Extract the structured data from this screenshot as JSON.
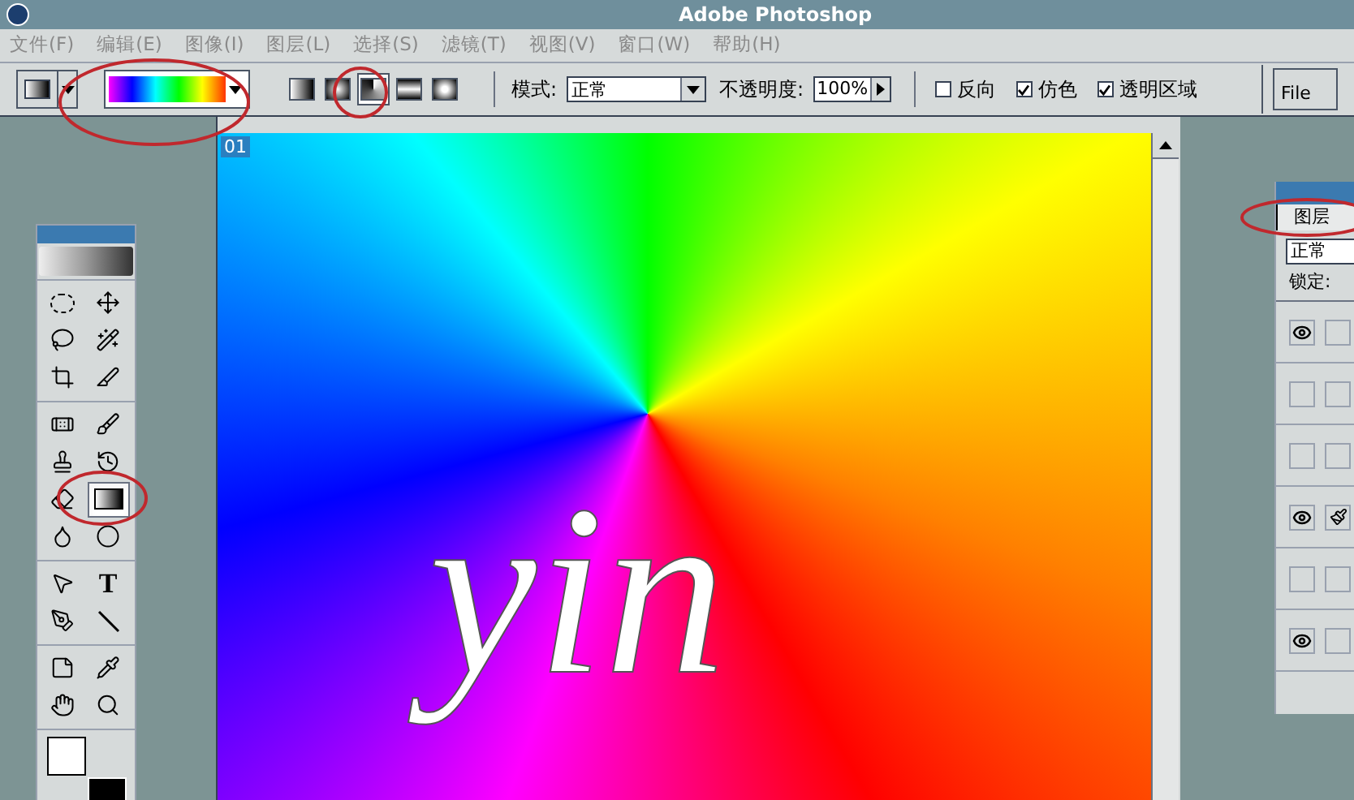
{
  "window": {
    "title": "Adobe Photoshop"
  },
  "menu": [
    "文件(F)",
    "编辑(E)",
    "图像(I)",
    "图层(L)",
    "选择(S)",
    "滤镜(T)",
    "视图(V)",
    "窗口(W)",
    "帮助(H)"
  ],
  "options_bar": {
    "gradient_types": [
      {
        "kind": "linear",
        "selected": false
      },
      {
        "kind": "radial",
        "selected": false
      },
      {
        "kind": "angle",
        "selected": true
      },
      {
        "kind": "reflected",
        "selected": false
      },
      {
        "kind": "diamond",
        "selected": false
      }
    ],
    "mode_label": "模式:",
    "mode": "正常",
    "opacity_label": "不透明度:",
    "opacity": "100%",
    "checkboxes": [
      {
        "label": "反向",
        "checked": false
      },
      {
        "label": "仿色",
        "checked": true
      },
      {
        "label": "透明区域",
        "checked": true
      }
    ],
    "palette_well": "File"
  },
  "document": {
    "corner_label": "01",
    "canvas_text": "yin"
  },
  "toolbox": {
    "tools": [
      {
        "kind": "marquee",
        "selected": false
      },
      {
        "kind": "move",
        "selected": false
      },
      {
        "kind": "lasso",
        "selected": false
      },
      {
        "kind": "wand",
        "selected": false
      },
      {
        "kind": "crop",
        "selected": false
      },
      {
        "kind": "slice",
        "selected": false
      },
      {
        "kind": "heal",
        "selected": false
      },
      {
        "kind": "brush",
        "selected": false
      },
      {
        "kind": "stamp",
        "selected": false
      },
      {
        "kind": "history",
        "selected": false
      },
      {
        "kind": "eraser",
        "selected": false
      },
      {
        "kind": "gradient",
        "selected": true
      },
      {
        "kind": "smudge",
        "selected": false
      },
      {
        "kind": "burn",
        "selected": false
      },
      {
        "kind": "select",
        "selected": false
      },
      {
        "kind": "type",
        "selected": false,
        "glyph": "T"
      },
      {
        "kind": "pen",
        "selected": false
      },
      {
        "kind": "line",
        "selected": false
      },
      {
        "kind": "notes",
        "selected": false
      },
      {
        "kind": "eyedropper",
        "selected": false
      },
      {
        "kind": "hand",
        "selected": false
      },
      {
        "kind": "zoom",
        "selected": false
      }
    ]
  },
  "layers_panel": {
    "tab": "图层",
    "blend_mode": "正常",
    "lock_label": "锁定:",
    "layers": [
      {
        "visible": true,
        "brush": false
      },
      {
        "visible": false,
        "brush": false
      },
      {
        "visible": false,
        "brush": false
      },
      {
        "visible": true,
        "brush": true
      },
      {
        "visible": false,
        "brush": false
      },
      {
        "visible": true,
        "brush": false
      }
    ]
  }
}
